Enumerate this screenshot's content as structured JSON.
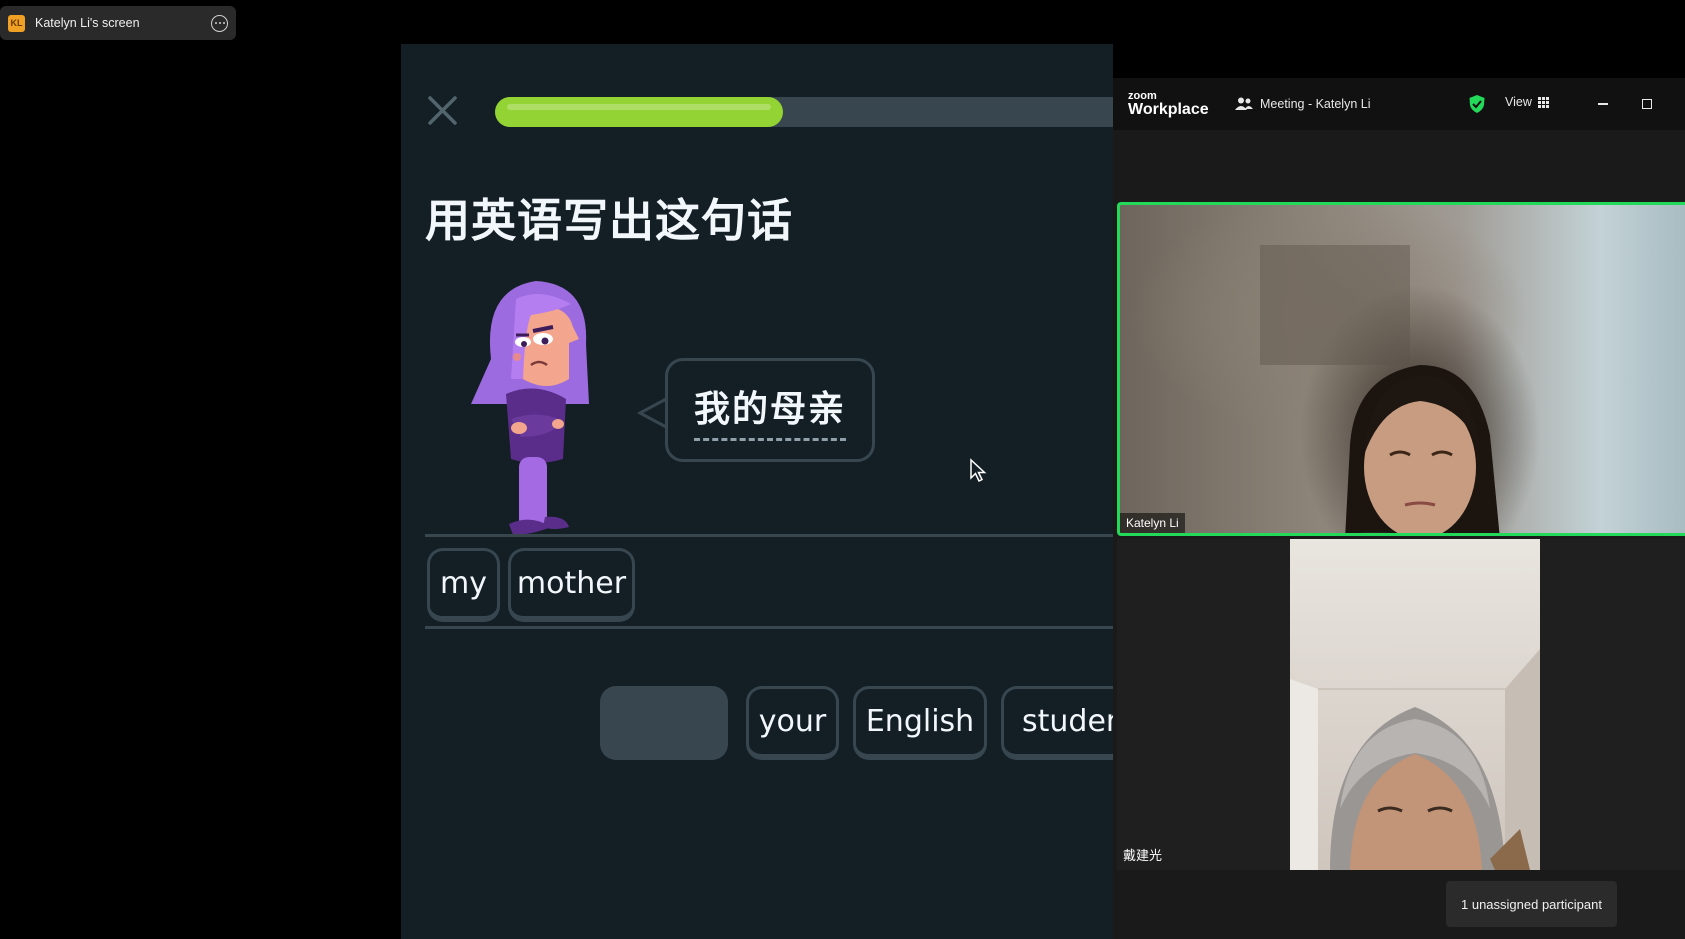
{
  "share_bar": {
    "avatar_initials": "KL",
    "label": "Katelyn Li's screen",
    "more_icon": "more-options-icon"
  },
  "lesson": {
    "close_icon": "close-icon",
    "progress_fraction": 0.45,
    "prompt_title": "用英语写出这句话",
    "character_icon": "lily-character-illustration",
    "bubble_text": "我的母亲",
    "answer_chips": [
      "my",
      "mother"
    ],
    "word_bank": [
      "your",
      "English",
      "studen"
    ],
    "colors": {
      "background": "#141f25",
      "border": "#37464f",
      "progress": "#93d333",
      "text": "#f1f7fb"
    }
  },
  "zoom": {
    "logo_small": "zoom",
    "logo_big": "Workplace",
    "meeting_title": "Meeting - Katelyn Li",
    "view_label": "View",
    "participants": [
      {
        "name": "Katelyn Li",
        "active_speaker": true
      },
      {
        "name": "戴建光",
        "active_speaker": false
      }
    ],
    "unassigned_label": "1 unassigned participant",
    "colors": {
      "active_border": "#23d959",
      "shield": "#23d959"
    }
  }
}
